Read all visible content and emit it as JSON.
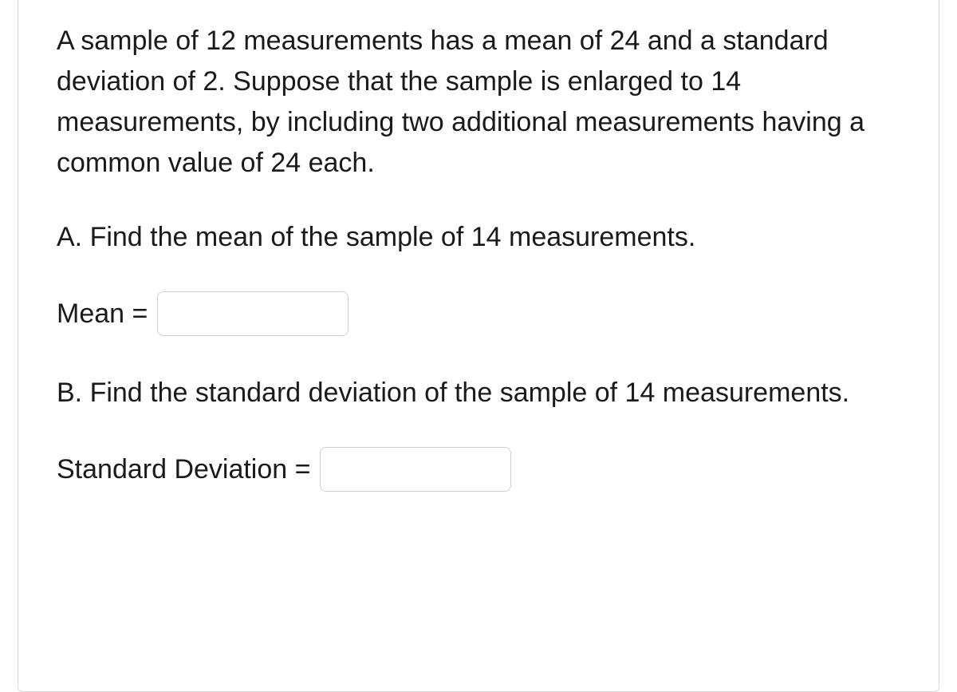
{
  "question": {
    "intro": "A sample of 12 measurements has a mean of 24 and a standard deviation of 2. Suppose that the sample is enlarged to 14 measurements, by including two additional measurements having a common value of 24 each.",
    "partA": {
      "prompt": "A. Find the mean of the sample of 14 measurements.",
      "label": "Mean =",
      "value": ""
    },
    "partB": {
      "prompt": "B. Find the standard deviation of the sample of 14 measurements.",
      "label": "Standard Deviation =",
      "value": ""
    }
  }
}
